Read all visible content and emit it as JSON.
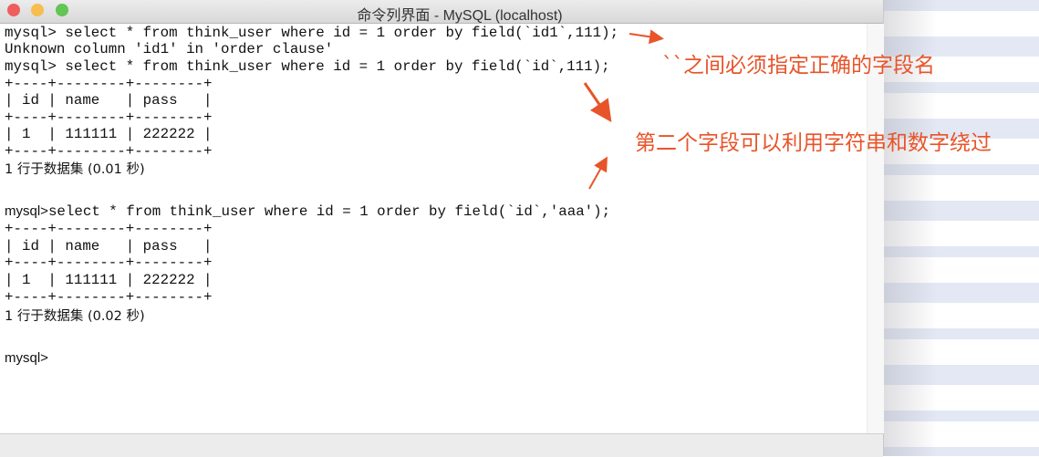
{
  "window": {
    "title": "命令列界面 - MySQL (localhost)",
    "traffic_lights": {
      "close": "#ee5f5b",
      "minimize": "#f6be4f",
      "zoom": "#62c554"
    }
  },
  "terminal": {
    "lines": [
      "mysql> select * from think_user where id = 1 order by field(`id1`,111);",
      "Unknown column 'id1' in 'order clause'",
      "mysql> select * from think_user where id = 1 order by field(`id`,111);",
      "+----+--------+--------+",
      "| id | name   | pass   |",
      "+----+--------+--------+",
      "| 1  | 111111 | 222222 |",
      "+----+--------+--------+",
      "1 行于数据集 (0.01 秒)",
      "select * from think_user where id = 1 order by field(`id`,'aaa');",
      "+----+--------+--------+",
      "| id | name   | pass   |",
      "+----+--------+--------+",
      "| 1  | 111111 | 222222 |",
      "+----+--------+--------+",
      "1 行于数据集 (0.02 秒)"
    ],
    "prompt": "mysql>"
  },
  "annotations": {
    "note1": "``之间必须指定正确的字段名",
    "note2": "第二个字段可以利用字符串和数字绕过",
    "color": "#e8542a"
  }
}
